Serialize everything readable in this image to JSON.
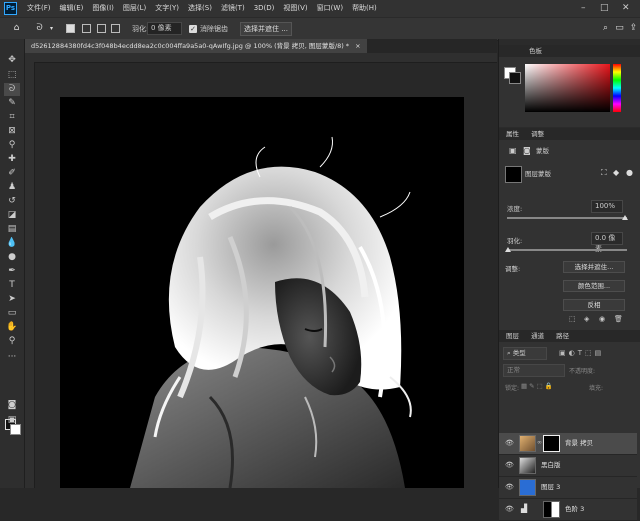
{
  "menu": {
    "logo": "Ps",
    "items": [
      "文件(F)",
      "编辑(E)",
      "图像(I)",
      "图层(L)",
      "文字(Y)",
      "选择(S)",
      "滤镜(T)",
      "3D(D)",
      "视图(V)",
      "窗口(W)",
      "帮助(H)"
    ]
  },
  "options": {
    "feather_label": "羽化:",
    "feather_value": "0 像素",
    "antialias_label": "消除锯齿",
    "select_mask_button": "选择并遮住 ..."
  },
  "document": {
    "tab_title": "d52612884380fd4c3f048b4ecdd8ea2c0c004ffa9a5a0-qAwIfg.jpg @ 100% (背景 拷贝, 图层蒙版/8) *"
  },
  "color_panel": {
    "tab_label": "色板"
  },
  "properties": {
    "tabs": [
      "属性",
      "调整"
    ],
    "mask_label": "蒙版",
    "layer_mask_label": "图层蒙版",
    "density_label": "浓度:",
    "density_value": "100%",
    "feather_label": "羽化:",
    "feather_value": "0.0 像素",
    "adjust_label": "调整:",
    "select_mask_button": "选择并遮住...",
    "color_range_button": "颜色范围...",
    "invert_button": "反相"
  },
  "layers_panel": {
    "tabs": [
      "图层",
      "通道",
      "路径"
    ],
    "kind_label": "类型",
    "blend_mode": "正常",
    "opacity_label": "不透明度:",
    "lock_label": "锁定:",
    "fill_label": "填充:",
    "layers": [
      {
        "name": "背景 拷贝"
      },
      {
        "name": "黑白版"
      },
      {
        "name": "图层 3"
      },
      {
        "name": "色阶 3"
      }
    ]
  },
  "colors": {
    "accent": "#31a8ff",
    "layer_blue": "#2a6dd4"
  }
}
